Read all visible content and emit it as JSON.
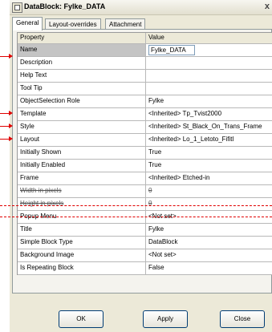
{
  "window": {
    "title": "DataBlock: Fylke_DATA",
    "close_symbol": "x"
  },
  "tabs": [
    {
      "label": "General",
      "active": true
    },
    {
      "label": "Layout-overrides",
      "active": false
    },
    {
      "label": "Attachment",
      "active": false
    }
  ],
  "grid": {
    "columns": [
      "Property",
      "Value"
    ],
    "rows": [
      {
        "property": "Name",
        "value": "Fylke_DATA"
      },
      {
        "property": "Description",
        "value": ""
      },
      {
        "property": "Help Text",
        "value": ""
      },
      {
        "property": "Tool Tip",
        "value": ""
      },
      {
        "property": "ObjectSelection Role",
        "value": "Fylke"
      },
      {
        "property": "Template",
        "value": "<Inherited> Tp_Tvist2000"
      },
      {
        "property": "Style",
        "value": "<Inherited> St_Black_On_Trans_Frame"
      },
      {
        "property": "Layout",
        "value": "<Inherited> Lo_1_Letoto_Fifitl"
      },
      {
        "property": "Initially Shown",
        "value": "True"
      },
      {
        "property": "Initially Enabled",
        "value": "True"
      },
      {
        "property": "Frame",
        "value": "<Inherited> Etched-in"
      },
      {
        "property": "Width in pixels",
        "value": "0"
      },
      {
        "property": "Height in pixels",
        "value": "0"
      },
      {
        "property": "Popup Menu",
        "value": "<Not set>"
      },
      {
        "property": "Title",
        "value": "Fylke"
      },
      {
        "property": "Simple Block Type",
        "value": "DataBlock"
      },
      {
        "property": "Background Image",
        "value": "<Not set>"
      },
      {
        "property": "Is Repeating Block",
        "value": "False"
      }
    ]
  },
  "buttons": {
    "ok": "OK",
    "apply": "Apply",
    "close": "Close"
  },
  "colors": {
    "annotation": "#e00000",
    "dialog_background": "#ece9d8"
  }
}
